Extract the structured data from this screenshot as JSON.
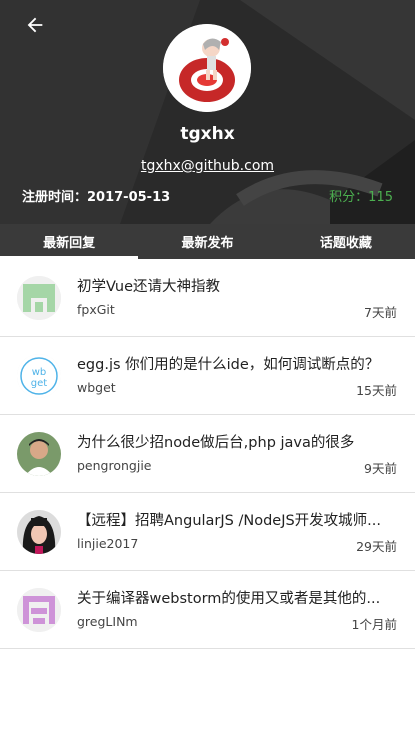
{
  "profile": {
    "username": "tgxhx",
    "email": "tgxhx@github.com",
    "register_label": "注册时间：2017-05-13",
    "score_label": "积分：115"
  },
  "tabs": [
    {
      "label": "最新回复",
      "active": true
    },
    {
      "label": "最新发布",
      "active": false
    },
    {
      "label": "话题收藏",
      "active": false
    }
  ],
  "replies": [
    {
      "title": "初学Vue还请大神指教",
      "author": "fpxGit",
      "time": "7天前",
      "avatar": "green-identicon"
    },
    {
      "title": "egg.js 你们用的是什么ide，如何调试断点的？",
      "author": "wbget",
      "time": "15天前",
      "avatar": "wbget-logo"
    },
    {
      "title": "为什么很少招node做后台,php java的很多",
      "author": "pengrongjie",
      "time": "9天前",
      "avatar": "user-photo-male"
    },
    {
      "title": "【远程】招聘AngularJS /NodeJS开发攻城师...",
      "author": "linjie2017",
      "time": "29天前",
      "avatar": "user-photo-female"
    },
    {
      "title": "关于编译器webstorm的使用又或者是其他的...",
      "author": "gregLINm",
      "time": "1个月前",
      "avatar": "pink-identicon"
    }
  ],
  "colors": {
    "header_bg": "#2b2b2b",
    "tab_bg": "#3a3a3a",
    "score": "#4caf50"
  }
}
